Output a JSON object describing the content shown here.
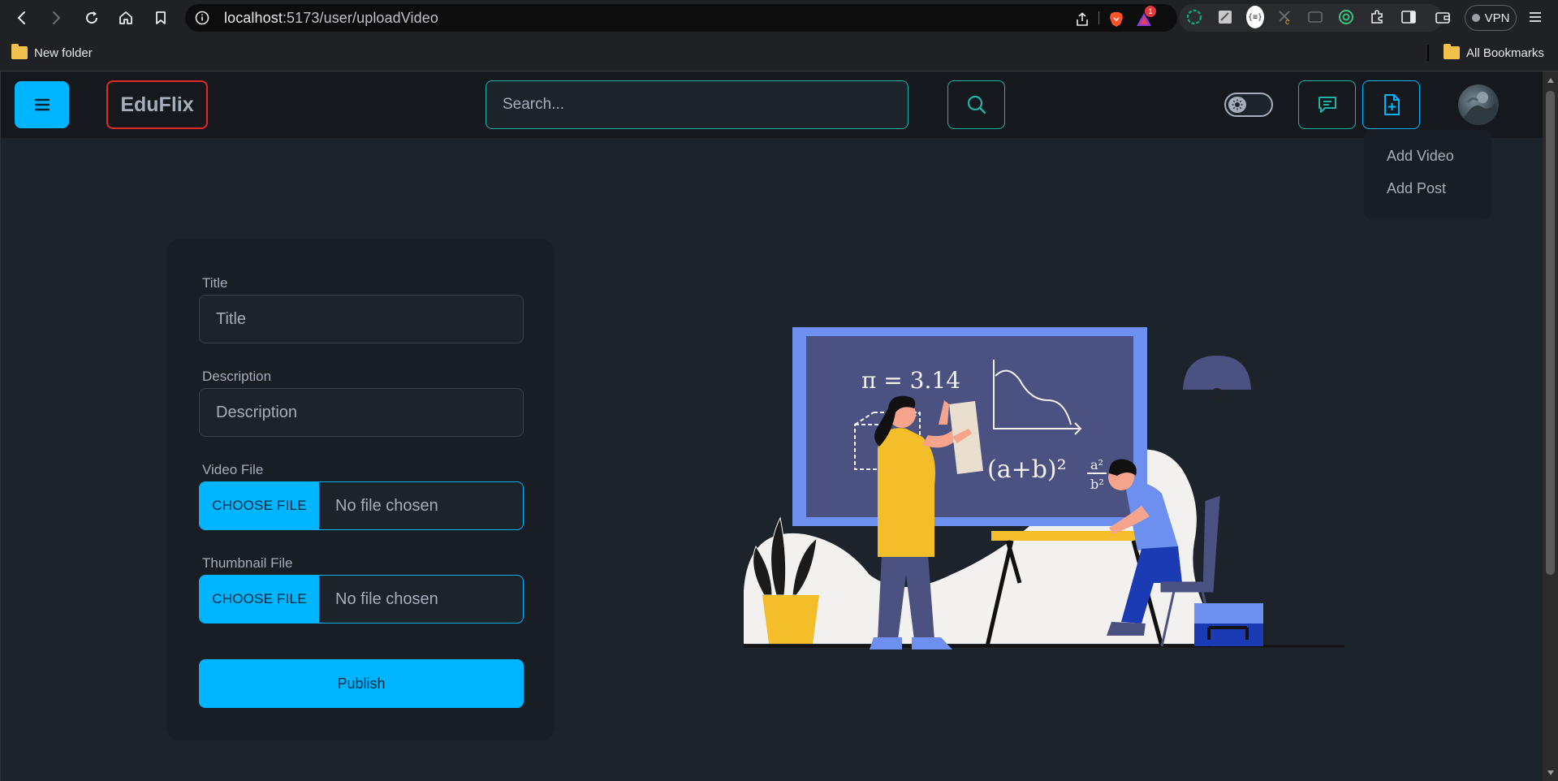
{
  "browser": {
    "url_host": "localhost",
    "url_path": ":5173/user/uploadVideo",
    "notification_count": "1",
    "vpn_label": "VPN",
    "bookmarks": {
      "folder_label": "New folder",
      "all_bookmarks_label": "All Bookmarks"
    }
  },
  "header": {
    "logo_text": "EduFlix",
    "search_placeholder": "Search...",
    "icons": [
      "menu-icon",
      "search-icon",
      "theme-toggle-icon",
      "message-icon",
      "add-document-icon"
    ]
  },
  "dropdown": {
    "items": [
      {
        "label": "Add Video"
      },
      {
        "label": "Add Post"
      }
    ]
  },
  "form": {
    "title_label": "Title",
    "title_placeholder": "Title",
    "description_label": "Description",
    "description_placeholder": "Description",
    "video_label": "Video File",
    "video_button": "CHOOSE FILE",
    "video_status": "No file chosen",
    "thumbnail_label": "Thumbnail File",
    "thumbnail_button": "CHOOSE FILE",
    "thumbnail_status": "No file chosen",
    "publish_label": "Publish"
  },
  "illustration": {
    "board_text_pi": "π = 3.14",
    "board_text_formula": "(a+b)²",
    "board_text_fraction_top": "a²",
    "board_text_fraction_bottom": "b²"
  },
  "colors": {
    "primary": "#00b5ff",
    "accent": "#1fb2a6",
    "logo_border": "#e02a2a",
    "background": "#1d232a",
    "card": "#191e24",
    "text": "#a6adbb"
  }
}
